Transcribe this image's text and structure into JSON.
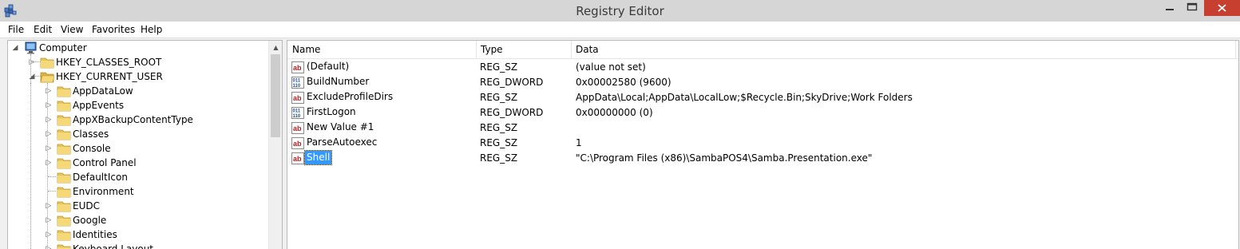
{
  "window": {
    "title": "Registry Editor"
  },
  "menu": [
    "File",
    "Edit",
    "View",
    "Favorites",
    "Help"
  ],
  "tree": {
    "root": {
      "label": "Computer",
      "icon": "computer-icon",
      "expanded": true
    },
    "hives": [
      {
        "label": "HKEY_CLASSES_ROOT",
        "expanded": false
      },
      {
        "label": "HKEY_CURRENT_USER",
        "expanded": true
      }
    ],
    "children": [
      {
        "label": "AppDataLow",
        "expandable": true
      },
      {
        "label": "AppEvents",
        "expandable": true
      },
      {
        "label": "AppXBackupContentType",
        "expandable": true
      },
      {
        "label": "Classes",
        "expandable": true
      },
      {
        "label": "Console",
        "expandable": true
      },
      {
        "label": "Control Panel",
        "expandable": true
      },
      {
        "label": "DefaultIcon",
        "expandable": false
      },
      {
        "label": "Environment",
        "expandable": false
      },
      {
        "label": "EUDC",
        "expandable": true
      },
      {
        "label": "Google",
        "expandable": true
      },
      {
        "label": "Identities",
        "expandable": true
      },
      {
        "label": "Keyboard Layout",
        "expandable": true
      }
    ]
  },
  "list": {
    "columns": [
      "Name",
      "Type",
      "Data"
    ],
    "rows": [
      {
        "name": "(Default)",
        "type": "REG_SZ",
        "data": "(value not set)",
        "icon": "string-value-icon",
        "selected": false
      },
      {
        "name": "BuildNumber",
        "type": "REG_DWORD",
        "data": "0x00002580 (9600)",
        "icon": "binary-value-icon",
        "selected": false
      },
      {
        "name": "ExcludeProfileDirs",
        "type": "REG_SZ",
        "data": "AppData\\Local;AppData\\LocalLow;$Recycle.Bin;SkyDrive;Work Folders",
        "icon": "string-value-icon",
        "selected": false
      },
      {
        "name": "FirstLogon",
        "type": "REG_DWORD",
        "data": "0x00000000 (0)",
        "icon": "binary-value-icon",
        "selected": false
      },
      {
        "name": "New Value #1",
        "type": "REG_SZ",
        "data": "",
        "icon": "string-value-icon",
        "selected": false
      },
      {
        "name": "ParseAutoexec",
        "type": "REG_SZ",
        "data": "1",
        "icon": "string-value-icon",
        "selected": false
      },
      {
        "name": "Shell",
        "type": "REG_SZ",
        "data": "\"C:\\Program Files (x86)\\SambaPOS4\\Samba.Presentation.exe\"",
        "icon": "string-value-icon",
        "selected": true
      }
    ]
  },
  "colors": {
    "selection": "#3399ff",
    "folder": "#e8c65a",
    "close_hover": "#c7402f"
  }
}
